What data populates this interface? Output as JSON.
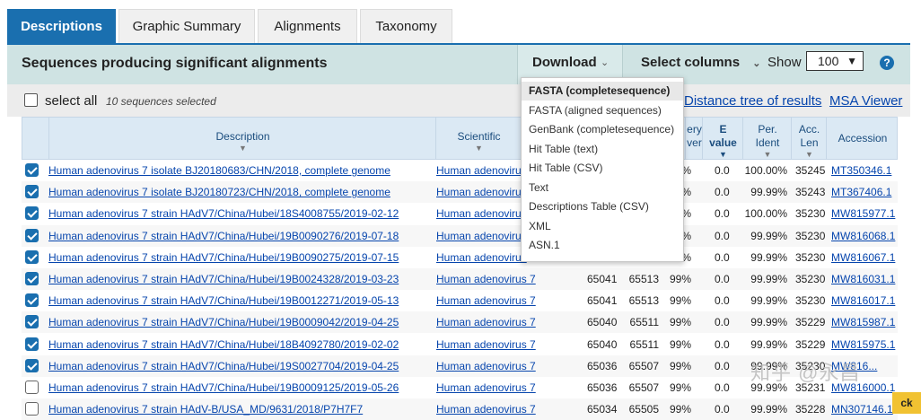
{
  "tabs": [
    "Descriptions",
    "Graphic Summary",
    "Alignments",
    "Taxonomy"
  ],
  "header": {
    "title": "Sequences producing significant alignments",
    "download_label": "Download",
    "select_columns_label": "Select columns",
    "show_label": "Show",
    "show_value": "100",
    "help_label": "?"
  },
  "subbar": {
    "select_all_label": "select all",
    "selected_count": "10 sequences selected",
    "distance_tree_link": "Distance tree of results",
    "msa_viewer_link": "MSA Viewer"
  },
  "table": {
    "headers": {
      "description": "Description",
      "scientific": "Scientific",
      "query_cover_a": "ery",
      "query_cover_b": "ver",
      "evalue_a": "E",
      "evalue_b": "value",
      "ident_a": "Per.",
      "ident_b": "Ident",
      "acclen_a": "Acc.",
      "acclen_b": "Len",
      "accession": "Accession"
    },
    "rows": [
      {
        "checked": true,
        "desc": "Human adenovirus 7 isolate BJ20180683/CHN/2018, complete genome",
        "sci": "Human adenovirus",
        "max": "",
        "total": "",
        "cover": "%",
        "e": "0.0",
        "ident": "100.00%",
        "len": "35245",
        "acc": "MT350346.1"
      },
      {
        "checked": true,
        "desc": "Human adenovirus 7 isolate BJ20180723/CHN/2018, complete genome",
        "sci": "Human adenovirus",
        "max": "",
        "total": "",
        "cover": "%",
        "e": "0.0",
        "ident": "99.99%",
        "len": "35243",
        "acc": "MT367406.1"
      },
      {
        "checked": true,
        "desc": "Human adenovirus 7 strain HAdV7/China/Hubei/18S4008755/2019-02-12",
        "sci": "Human adenovirus",
        "max": "",
        "total": "",
        "cover": "%",
        "e": "0.0",
        "ident": "100.00%",
        "len": "35230",
        "acc": "MW815977.1"
      },
      {
        "checked": true,
        "desc": "Human adenovirus 7 strain HAdV7/China/Hubei/19B0090276/2019-07-18",
        "sci": "Human adenovirus",
        "max": "",
        "total": "",
        "cover": "%",
        "e": "0.0",
        "ident": "99.99%",
        "len": "35230",
        "acc": "MW816068.1"
      },
      {
        "checked": true,
        "desc": "Human adenovirus 7 strain HAdV7/China/Hubei/19B0090275/2019-07-15",
        "sci": "Human adenovirus",
        "max": "",
        "total": "",
        "cover": "%",
        "e": "0.0",
        "ident": "99.99%",
        "len": "35230",
        "acc": "MW816067.1"
      },
      {
        "checked": true,
        "desc": "Human adenovirus 7 strain HAdV7/China/Hubei/19B0024328/2019-03-23",
        "sci": "Human adenovirus 7",
        "max": "65041",
        "total": "65513",
        "cover": "99%",
        "e": "0.0",
        "ident": "99.99%",
        "len": "35230",
        "acc": "MW816031.1"
      },
      {
        "checked": true,
        "desc": "Human adenovirus 7 strain HAdV7/China/Hubei/19B0012271/2019-05-13",
        "sci": "Human adenovirus 7",
        "max": "65041",
        "total": "65513",
        "cover": "99%",
        "e": "0.0",
        "ident": "99.99%",
        "len": "35230",
        "acc": "MW816017.1"
      },
      {
        "checked": true,
        "desc": "Human adenovirus 7 strain HAdV7/China/Hubei/19B0009042/2019-04-25",
        "sci": "Human adenovirus 7",
        "max": "65040",
        "total": "65511",
        "cover": "99%",
        "e": "0.0",
        "ident": "99.99%",
        "len": "35229",
        "acc": "MW815987.1"
      },
      {
        "checked": true,
        "desc": "Human adenovirus 7 strain HAdV7/China/Hubei/18B4092780/2019-02-02",
        "sci": "Human adenovirus 7",
        "max": "65040",
        "total": "65511",
        "cover": "99%",
        "e": "0.0",
        "ident": "99.99%",
        "len": "35229",
        "acc": "MW815975.1"
      },
      {
        "checked": true,
        "desc": "Human adenovirus 7 strain HAdV7/China/Hubei/19S0027704/2019-04-25",
        "sci": "Human adenovirus 7",
        "max": "65036",
        "total": "65507",
        "cover": "99%",
        "e": "0.0",
        "ident": "99.99%",
        "len": "35230",
        "acc": "MW816..."
      },
      {
        "checked": false,
        "desc": "Human adenovirus 7 strain HAdV7/China/Hubei/19B0009125/2019-05-26",
        "sci": "Human adenovirus 7",
        "max": "65036",
        "total": "65507",
        "cover": "99%",
        "e": "0.0",
        "ident": "99.99%",
        "len": "35231",
        "acc": "MW816000.1"
      },
      {
        "checked": false,
        "desc": "Human adenovirus 7 strain HAdV-B/USA_MD/9631/2018/P7H7F7",
        "sci": "Human adenovirus 7",
        "max": "65034",
        "total": "65505",
        "cover": "99%",
        "e": "0.0",
        "ident": "99.99%",
        "len": "35228",
        "acc": "MN307146.1"
      }
    ]
  },
  "download_menu": [
    "FASTA (completesequence)",
    "FASTA (aligned sequences)",
    "GenBank (completesequence)",
    "Hit Table (text)",
    "Hit Table (CSV)",
    "Text",
    "Descriptions Table (CSV)",
    "XML",
    "ASN.1"
  ],
  "watermark": "知乎 @永昌",
  "feedback_label": "ck",
  "colors": {
    "accent": "#1a6faf",
    "header_bar": "#cfe3e3",
    "link": "#0645ad",
    "feedback": "#f1c232"
  }
}
